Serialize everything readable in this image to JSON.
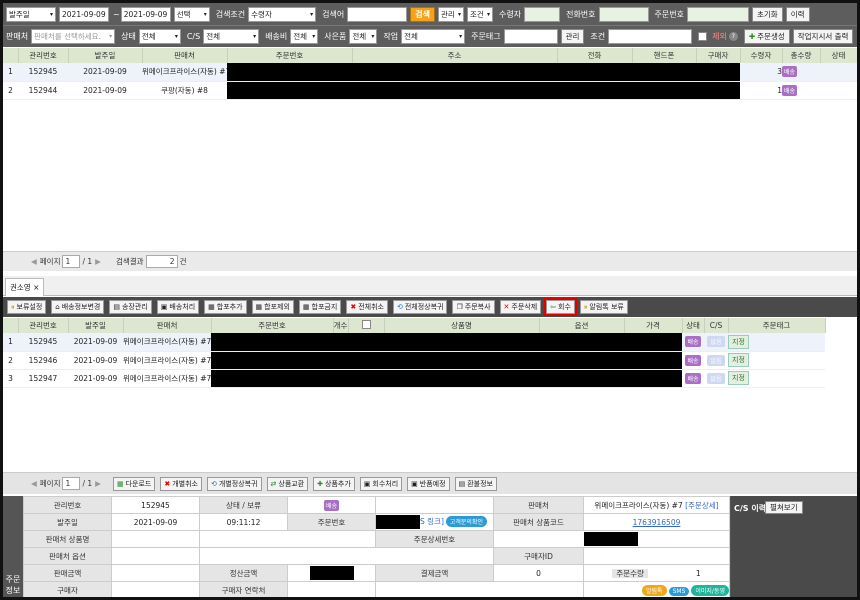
{
  "toolbar1": {
    "date_type": "발주일",
    "date_from": "2021-09-09",
    "tilde": "~",
    "date_to": "2021-09-09",
    "period": "선택",
    "search_cond_label": "검색조건",
    "search_cond": "수령자",
    "keyword_label": "검색어",
    "search_btn": "검색",
    "manage": "관리",
    "cond": "조건",
    "receiver_label": "수령자",
    "phone_label": "전화번호",
    "order_no_label": "주문번호",
    "reset_btn": "초기화",
    "history_btn": "이력"
  },
  "toolbar2": {
    "seller_label": "판매처",
    "seller_placeholder": "판매처를 선택하세요.",
    "status_label": "상태",
    "status": "전체",
    "cs_label": "C/S",
    "cs": "전체",
    "ship_label": "배송비",
    "ship": "전체",
    "gift_label": "사은품",
    "gift": "전체",
    "work_label": "작업",
    "work": "전체",
    "tag_label": "주문태그",
    "tag_manage_btn": "관리",
    "cond_label": "조건",
    "except_label": "제외",
    "create_order_btn": "주문생성",
    "print_btn": "작업지시서 출력"
  },
  "top_table": {
    "headers": [
      "관리번호",
      "발주일",
      "판매처",
      "주문번호",
      "주소",
      "전화",
      "핸드폰",
      "구매자",
      "수령자",
      "총수량",
      "상태"
    ],
    "rows": [
      {
        "idx": "1",
        "id": "152945",
        "date": "2021-09-09",
        "seller": "위메이크프라이스(자동) #7",
        "qty": "3",
        "status": "배송"
      },
      {
        "idx": "2",
        "id": "152944",
        "date": "2021-09-09",
        "seller": "쿠팡(자동) #8",
        "qty": "1",
        "status": "배송"
      }
    ]
  },
  "top_pager": {
    "page_label": "페이지",
    "page": "1",
    "total": "/ 1",
    "result_label": "검색결과",
    "count": "2",
    "unit": "건"
  },
  "tab": {
    "label": "권소영",
    "close": "×"
  },
  "action_bar": [
    "보류설정",
    "배송정보변경",
    "송장관리",
    "배송처리",
    "합포추가",
    "합포제외",
    "합포금지",
    "전체취소",
    "전체정상복귀",
    "주문복사",
    "주문삭제",
    "회수",
    "알림톡 보류"
  ],
  "mid_table": {
    "headers": [
      "관리번호",
      "발주일",
      "판매처",
      "주문번호",
      "개수",
      "",
      "상품명",
      "옵션",
      "가격",
      "상태",
      "C/S",
      "주문태그"
    ],
    "rows": [
      {
        "idx": "1",
        "id": "152945",
        "date": "2021-09-09",
        "seller": "위메이크프라이스(자동) #7",
        "status": "배송",
        "cs": "없음",
        "tag": "지정"
      },
      {
        "idx": "2",
        "id": "152946",
        "date": "2021-09-09",
        "seller": "위메이크프라이스(자동) #7",
        "status": "배송",
        "cs": "없음",
        "tag": "지정"
      },
      {
        "idx": "3",
        "id": "152947",
        "date": "2021-09-09",
        "seller": "위메이크프라이스(자동) #7",
        "status": "배송",
        "cs": "없음",
        "tag": "지정"
      }
    ]
  },
  "mid_pager": {
    "page_label": "페이지",
    "page": "1",
    "total": "/ 1"
  },
  "bottom_bar": [
    "다운로드",
    "개별취소",
    "개별정상복귀",
    "상품교환",
    "상품추가",
    "회수처리",
    "반품예정",
    "환불정보"
  ],
  "detail": {
    "side_label": "주문 정보",
    "k_manage": "관리번호",
    "v_manage": "152945",
    "k_status": "상태 / 보류",
    "v_status": "배송",
    "k_seller": "판매처",
    "v_seller": "위메이크프라이스(자동) #7",
    "v_seller_link": "[주문상세]",
    "k_date": "발주일",
    "v_date": "2021-09-09",
    "v_time": "09:11:12",
    "k_order_no": "주문번호",
    "v_link_suffix": "S 링크]",
    "v_confirm": "고객문의확인",
    "k_prod_code": "판매처 상품코드",
    "v_prod_code": "1763916509",
    "k_prod_name": "판매처 상품명",
    "k_order_detail": "주문상세번호",
    "k_option": "판매처 옵션",
    "k_buyer_id": "구매자ID",
    "k_sale_amount": "판매금액",
    "k_settle": "정산금액",
    "k_pay": "결제금액",
    "v_pay": "0",
    "k_qty": "주문수량",
    "v_qty": "1",
    "k_buyer": "구매자",
    "k_buyer_phone": "구매자 연락처",
    "pill1": "알림톡",
    "pill2": "SMS",
    "pill3": "이미지/동영",
    "cs_history": "C/S 이력",
    "cs_expand": "펼쳐보기"
  }
}
